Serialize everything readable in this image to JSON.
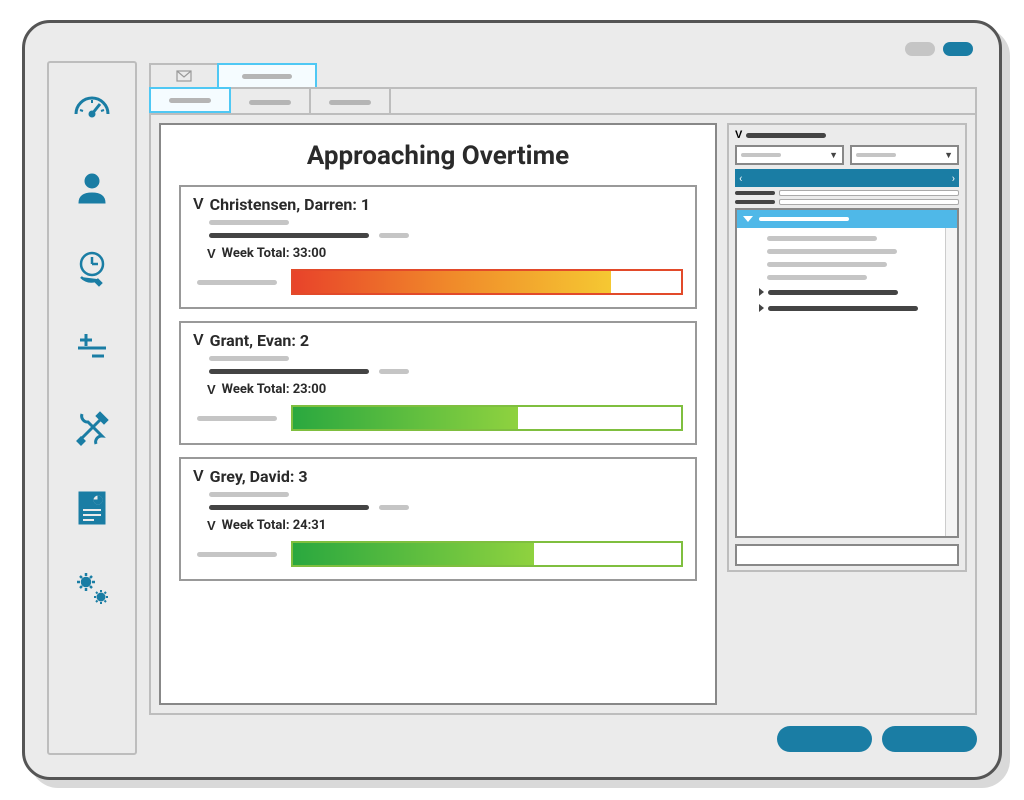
{
  "report": {
    "title": "Approaching Overtime",
    "employees": [
      {
        "name": "Christensen, Darren",
        "rank": 1,
        "week_total": "33:00",
        "meter_pct": 82,
        "meter_color": "red"
      },
      {
        "name": "Grant, Evan",
        "rank": 2,
        "week_total": "23:00",
        "meter_pct": 58,
        "meter_color": "green"
      },
      {
        "name": "Grey, David",
        "rank": 3,
        "week_total": "24:31",
        "meter_pct": 62,
        "meter_color": "green"
      }
    ]
  },
  "sidebar": {
    "items": [
      "dashboard",
      "profile",
      "time",
      "adjustments",
      "tools",
      "reports",
      "settings"
    ]
  },
  "week_label": "Week Total:"
}
